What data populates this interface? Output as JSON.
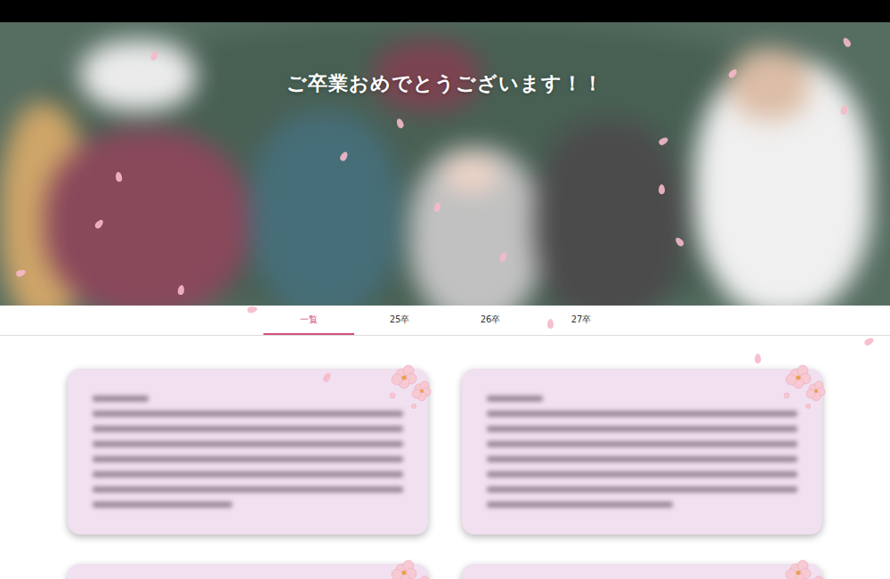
{
  "hero": {
    "title": "ご卒業おめでとうございます！！"
  },
  "tabs": [
    {
      "label": "一覧",
      "selected": true
    },
    {
      "label": "25卒",
      "selected": false
    },
    {
      "label": "26卒",
      "selected": false
    },
    {
      "label": "27卒",
      "selected": false
    }
  ]
}
